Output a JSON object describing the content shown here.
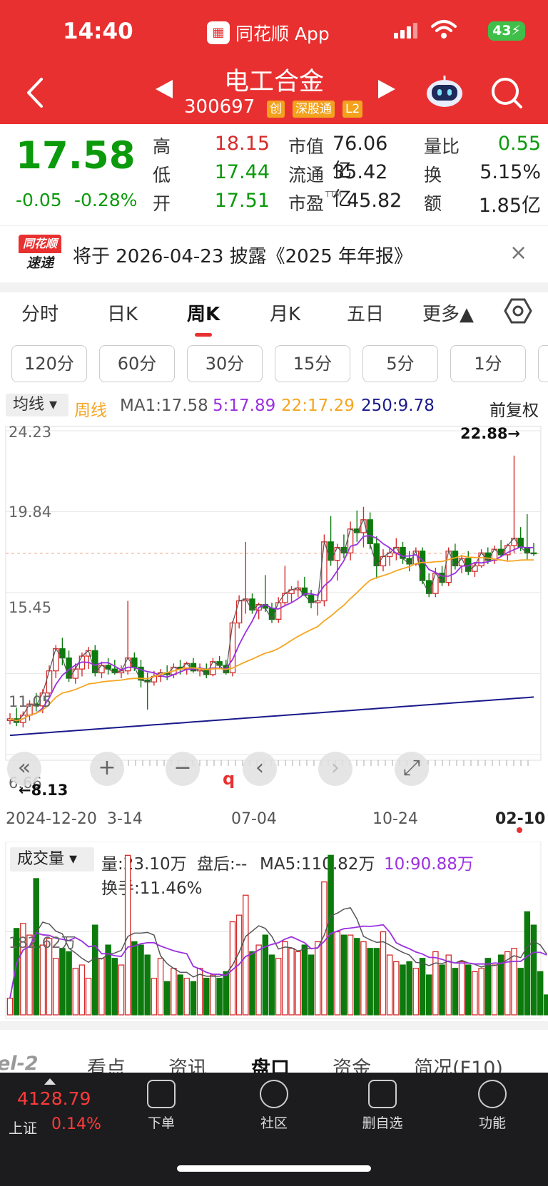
{
  "status_bar": {
    "time": "14:40",
    "app_name": "同花顺 App",
    "battery": "43"
  },
  "header": {
    "stock_name": "电工合金",
    "stock_code": "300697",
    "tags": [
      "创",
      "深股通",
      "L2"
    ],
    "tag_colors": [
      "#f3a21d",
      "#f3a21d",
      "#f3a21d"
    ]
  },
  "quote": {
    "price": "17.58",
    "change": "-0.05",
    "change_pct": "-0.28%",
    "high_label": "高",
    "high": "18.15",
    "low_label": "低",
    "low": "17.44",
    "open_label": "开",
    "open": "17.51",
    "mcap_label": "市值",
    "mcap": "76.06亿",
    "float_label": "流通",
    "float": "35.42亿",
    "pe_label": "市盈",
    "pe_sup": "TTM",
    "pe": "45.82",
    "vol_ratio_label": "量比",
    "vol_ratio": "0.55",
    "turnover_label": "换",
    "turnover": "5.15%",
    "amount_label": "额",
    "amount": "1.85亿"
  },
  "notice": {
    "logo_top": "同花顺",
    "logo_bottom": "速递",
    "text": "将于 2026-04-23 披露《2025 年年报》",
    "close": "×"
  },
  "tabs": [
    {
      "label": "分时"
    },
    {
      "label": "日K"
    },
    {
      "label": "周K"
    },
    {
      "label": "月K"
    },
    {
      "label": "五日"
    },
    {
      "label": "更多▲"
    }
  ],
  "active_tab": "周K",
  "minute_buttons": [
    "120分",
    "60分",
    "30分",
    "15分",
    "5分",
    "1分"
  ],
  "indicator": {
    "selector": "均线 ▾",
    "period": "周线",
    "ma1": "MA1:17.58",
    "ma5": "5:17.89",
    "ma22": "22:17.29",
    "ma250": "250:9.78",
    "adjust": "前复权"
  },
  "colors": {
    "up": "#d62b2b",
    "down": "#0c7a0c",
    "ma5": "#9b30e0",
    "ma22": "#f5a623",
    "ma250": "#1a1a8c",
    "ma1": "#555555"
  },
  "chart_data": {
    "type": "candlestick",
    "y_ticks": [
      "24.23",
      "19.84",
      "15.45",
      "11.05",
      "6.66"
    ],
    "ylim": [
      6.66,
      24.23
    ],
    "max_marker": "22.88→",
    "min_marker": "←8.13",
    "x_labels": [
      "2024-12-20",
      "3-14",
      "07-04",
      "10-24",
      "02-10"
    ],
    "candles_ohlc": [
      [
        8.5,
        8.9,
        8.3,
        8.6
      ],
      [
        8.6,
        9.2,
        8.2,
        8.4
      ],
      [
        8.4,
        9.0,
        8.13,
        8.8
      ],
      [
        8.8,
        9.6,
        8.5,
        9.4
      ],
      [
        9.4,
        10.0,
        9.0,
        9.3
      ],
      [
        9.3,
        10.2,
        8.9,
        10.0
      ],
      [
        10.0,
        11.5,
        9.8,
        11.2
      ],
      [
        11.2,
        12.6,
        10.8,
        12.4
      ],
      [
        12.4,
        13.0,
        11.5,
        11.9
      ],
      [
        11.9,
        12.3,
        10.6,
        10.8
      ],
      [
        10.8,
        11.6,
        10.5,
        11.3
      ],
      [
        11.3,
        12.2,
        10.9,
        12.0
      ],
      [
        12.0,
        12.5,
        11.3,
        12.3
      ],
      [
        12.3,
        12.6,
        10.9,
        11.1
      ],
      [
        11.1,
        11.7,
        10.8,
        11.5
      ],
      [
        11.5,
        11.9,
        11.0,
        11.3
      ],
      [
        11.3,
        11.8,
        11.0,
        11.1
      ],
      [
        11.1,
        11.5,
        10.8,
        11.2
      ],
      [
        11.2,
        15.0,
        11.0,
        11.9
      ],
      [
        11.9,
        12.2,
        11.2,
        11.4
      ],
      [
        11.4,
        11.8,
        10.3,
        10.7
      ],
      [
        10.7,
        11.1,
        9.1,
        10.6
      ],
      [
        10.6,
        11.2,
        10.4,
        10.9
      ],
      [
        10.9,
        11.3,
        10.6,
        11.1
      ],
      [
        11.1,
        11.5,
        10.7,
        11.0
      ],
      [
        11.0,
        11.6,
        10.8,
        11.4
      ],
      [
        11.4,
        11.8,
        11.0,
        11.3
      ],
      [
        11.3,
        11.7,
        11.0,
        11.6
      ],
      [
        11.6,
        11.9,
        11.1,
        11.2
      ],
      [
        11.2,
        11.6,
        10.9,
        11.3
      ],
      [
        11.3,
        11.6,
        10.8,
        11.0
      ],
      [
        11.0,
        11.9,
        10.9,
        11.7
      ],
      [
        11.7,
        12.0,
        11.3,
        11.5
      ],
      [
        11.5,
        11.8,
        11.0,
        11.1
      ],
      [
        11.1,
        13.9,
        10.9,
        13.8
      ],
      [
        13.8,
        15.3,
        13.5,
        15.0
      ],
      [
        15.0,
        18.2,
        14.3,
        15.1
      ],
      [
        15.1,
        15.4,
        14.3,
        14.5
      ],
      [
        14.5,
        14.9,
        14.0,
        14.8
      ],
      [
        14.8,
        16.4,
        14.4,
        14.6
      ],
      [
        14.6,
        14.9,
        13.8,
        14.0
      ],
      [
        14.0,
        15.2,
        13.8,
        14.9
      ],
      [
        14.9,
        16.9,
        14.7,
        15.4
      ],
      [
        15.4,
        15.8,
        14.9,
        15.6
      ],
      [
        15.6,
        16.1,
        15.2,
        15.7
      ],
      [
        15.7,
        16.3,
        15.3,
        15.3
      ],
      [
        15.3,
        15.6,
        14.6,
        14.9
      ],
      [
        14.9,
        15.4,
        14.2,
        15.0
      ],
      [
        15.0,
        18.6,
        14.7,
        18.2
      ],
      [
        18.2,
        19.6,
        16.9,
        17.2
      ],
      [
        17.2,
        18.1,
        16.1,
        17.9
      ],
      [
        17.9,
        18.6,
        17.3,
        17.6
      ],
      [
        17.6,
        19.3,
        17.2,
        18.9
      ],
      [
        18.9,
        19.9,
        18.2,
        18.7
      ],
      [
        18.7,
        20.1,
        17.9,
        19.4
      ],
      [
        19.4,
        19.8,
        17.8,
        18.1
      ],
      [
        18.1,
        18.5,
        16.2,
        16.9
      ],
      [
        16.9,
        17.8,
        16.6,
        17.4
      ],
      [
        17.4,
        17.9,
        16.9,
        17.6
      ],
      [
        17.6,
        18.4,
        17.2,
        17.9
      ],
      [
        17.9,
        18.2,
        17.0,
        17.3
      ],
      [
        17.3,
        17.7,
        16.6,
        17.0
      ],
      [
        17.0,
        17.9,
        16.9,
        17.7
      ],
      [
        17.7,
        17.9,
        15.9,
        16.1
      ],
      [
        16.1,
        16.5,
        15.2,
        15.4
      ],
      [
        15.4,
        16.8,
        15.2,
        16.5
      ],
      [
        16.5,
        16.9,
        15.8,
        16.0
      ],
      [
        16.0,
        17.9,
        15.8,
        17.7
      ],
      [
        17.7,
        18.1,
        16.7,
        16.9
      ],
      [
        16.9,
        17.5,
        16.5,
        17.3
      ],
      [
        17.3,
        17.7,
        16.4,
        16.6
      ],
      [
        16.6,
        17.1,
        16.3,
        16.9
      ],
      [
        16.9,
        17.8,
        16.8,
        17.6
      ],
      [
        17.6,
        17.9,
        17.0,
        17.2
      ],
      [
        17.2,
        18.0,
        17.0,
        17.8
      ],
      [
        17.8,
        18.3,
        17.4,
        17.5
      ],
      [
        17.5,
        18.1,
        17.2,
        18.0
      ],
      [
        18.0,
        22.88,
        17.6,
        18.4
      ],
      [
        18.4,
        19.0,
        17.7,
        17.9
      ],
      [
        17.9,
        19.7,
        17.2,
        17.6
      ],
      [
        17.6,
        18.15,
        17.44,
        17.58
      ]
    ],
    "ma_labels": [
      "MA1",
      "MA5",
      "MA22",
      "MA250"
    ]
  },
  "chart_controls": [
    "«",
    "+",
    "−",
    "‹",
    "›",
    "⤢"
  ],
  "q_marker": "q",
  "volume": {
    "selector": "成交量 ▾",
    "vol": "量:23.10万",
    "after_hours": "盘后:--",
    "ma5": "MA5:110.82万",
    "ma10": "10:90.88万",
    "turnover": "换手:11.46%",
    "y_label": "182.62万",
    "bars": [
      10,
      52,
      55,
      48,
      82,
      42,
      46,
      34,
      40,
      38,
      28,
      30,
      22,
      54,
      34,
      42,
      34,
      30,
      96,
      44,
      42,
      36,
      22,
      34,
      20,
      28,
      24,
      22,
      20,
      28,
      22,
      24,
      22,
      26,
      56,
      60,
      72,
      38,
      42,
      48,
      36,
      34,
      44,
      40,
      38,
      42,
      36,
      44,
      80,
      96,
      50,
      48,
      48,
      46,
      44,
      40,
      40,
      50,
      36,
      32,
      30,
      32,
      28,
      34,
      24,
      38,
      30,
      36,
      28,
      32,
      30,
      26,
      28,
      34,
      30,
      36,
      38,
      40,
      28,
      62,
      54,
      26,
      12
    ]
  },
  "bottom_tabs": [
    "el-2",
    "看点",
    "资讯",
    "盘口",
    "资金",
    "简况(F10)"
  ],
  "index": {
    "value": "4128.79",
    "name": "上证",
    "pct": "0.14%"
  },
  "bottom_nav": [
    "下单",
    "社区",
    "删自选",
    "功能"
  ]
}
